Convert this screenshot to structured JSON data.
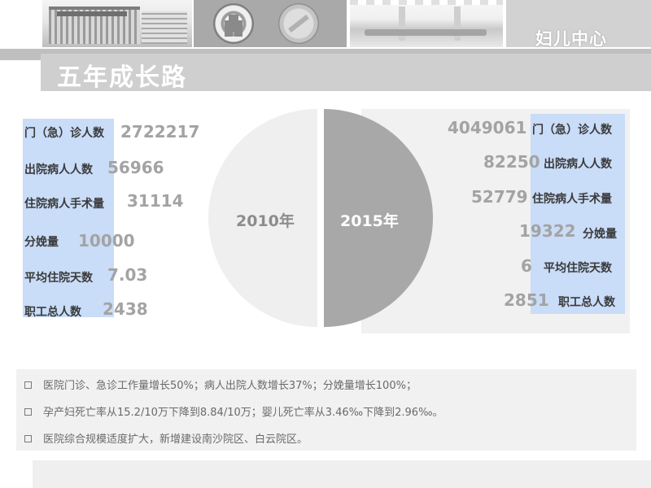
{
  "header": {
    "brand": "妇儿中心",
    "title": "五年成长路"
  },
  "icons": [
    "hospital-building-photo",
    "hospital-emblem-logo",
    "partner-seal-logo",
    "lobby-interior-photo"
  ],
  "colors": {
    "title_bar": "#cfcfcf",
    "highlight_band": "#c9dcf8",
    "pie_2010": "#efefef",
    "pie_2015": "#a8a8a8",
    "value_text": "#a3a3a3"
  },
  "stats_2010": [
    {
      "label": "门（急）诊人数",
      "value": "2722217"
    },
    {
      "label": "出院病人人数",
      "value": "56966"
    },
    {
      "label": "住院病人手术量",
      "value": "31114"
    },
    {
      "label": "分娩量",
      "value": "10000"
    },
    {
      "label": "平均住院天数",
      "value": "7.03"
    },
    {
      "label": "职工总人数",
      "value": "2438"
    }
  ],
  "stats_2015": [
    {
      "label": "门（急）诊人数",
      "value": "4049061"
    },
    {
      "label": "出院病人人数",
      "value": "82250"
    },
    {
      "label": "住院病人手术量",
      "value": "52779"
    },
    {
      "label": "分娩量",
      "value": "19322"
    },
    {
      "label": "平均住院天数",
      "value": "6"
    },
    {
      "label": "职工总人数",
      "value": "2851"
    }
  ],
  "pie": {
    "left_label": "2010年",
    "right_label": "2015年"
  },
  "summary": [
    "医院门诊、急诊工作量增长50%；病人出院人数增长37%；分娩量增长100%；",
    "孕产妇死亡率从15.2/10万下降到8.84/10万；婴儿死亡率从3.46‰下降到2.96‰。",
    "医院综合规模适度扩大，新增建设南沙院区、白云院区。"
  ]
}
